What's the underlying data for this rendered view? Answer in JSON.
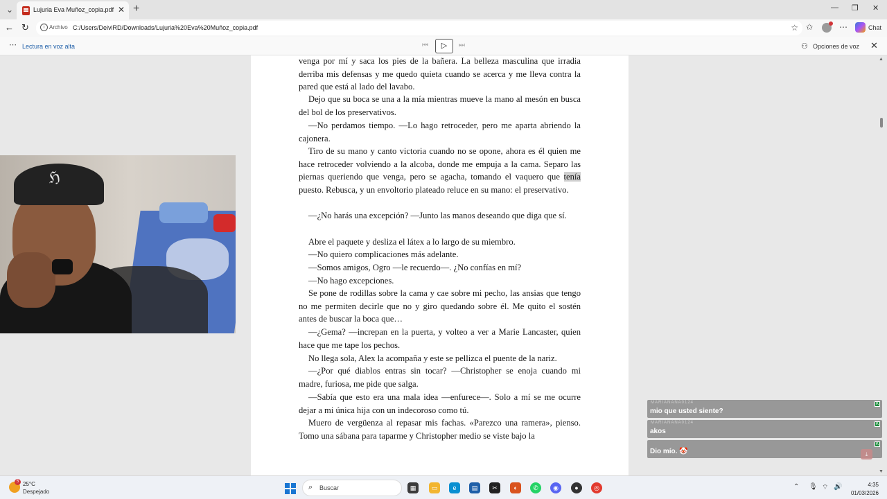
{
  "browser": {
    "tab_title": "Lujuria Eva Muñoz_copia.pdf",
    "new_tab_symbol": "+",
    "address_label": "Archivo",
    "url": "C:/Users/DeiviRD/Downloads/Lujuria%20Eva%20Muñoz_copia.pdf",
    "chat_label": "Chat"
  },
  "read_aloud": {
    "label": "Lectura en voz alta",
    "voice_options": "Opciones de voz"
  },
  "document": {
    "paragraphs": [
      "venga por mí y saca los pies de la bañera. La belleza masculina que irradia derriba mis defensas y me quedo quieta cuando se acerca y me lleva contra la pared que está al lado del lavabo.",
      "Dejo que su boca se una a la mía mientras mueve la mano al mesón en busca del bol de los preservativos.",
      "—No perdamos tiempo. —Lo hago retroceder, pero me aparta abriendo la cajonera.",
      "Tiro de su mano y canto victoria cuando no se opone, ahora es él quien me hace retroceder volviendo a la alcoba, donde me empuja a la cama. Separo las piernas queriendo que venga, pero se agacha, tomando el vaquero que",
      "tenía",
      "puesto. Rebusca, y un envoltorio plateado reluce en su mano: el preservativo.",
      "—¿No harás una excepción? —Junto las manos deseando que diga que sí.",
      "Abre el paquete y desliza el látex a lo largo de su miembro.",
      "—No quiero complicaciones más adelante.",
      "—Somos amigos, Ogro —le recuerdo—. ¿No confías en mí?",
      "—No hago excepciones.",
      "Se pone de rodillas sobre la cama y cae sobre mi pecho, las ansias que tengo no me permiten decirle que no y giro quedando sobre él. Me quito el sostén antes de buscar la boca que…",
      "—¿Gema? —increpan en la puerta, y volteo a ver a Marie Lancaster, quien hace que me tape los pechos.",
      "No llega sola, Alex la acompaña y este se pellizca el puente de la nariz.",
      "—¿Por qué diablos entras sin tocar? —Christopher se enoja cuando mi madre, furiosa, me pide que salga.",
      "—Sabía que esto era una mala idea —enfurece—. Solo a mí se me ocurre dejar a mi única hija con un indecoroso como tú.",
      "Muero de vergüenza al repasar mis fachas. «Parezco una ramera», pienso. Tomo una sábana para taparme y Christopher medio se viste bajo la"
    ]
  },
  "chat_overlay": {
    "messages": [
      {
        "user": "MARIANANA0124",
        "text": "mio que usted siente?"
      },
      {
        "user": "MARIANANA0124",
        "text": "akos"
      },
      {
        "user": "",
        "text": "Dio mío. 🤡"
      }
    ]
  },
  "taskbar": {
    "temperature": "25°C",
    "condition": "Despejado",
    "weather_badge": "5",
    "search_placeholder": "Buscar",
    "time": "4:35",
    "date": "01/03/2026"
  }
}
